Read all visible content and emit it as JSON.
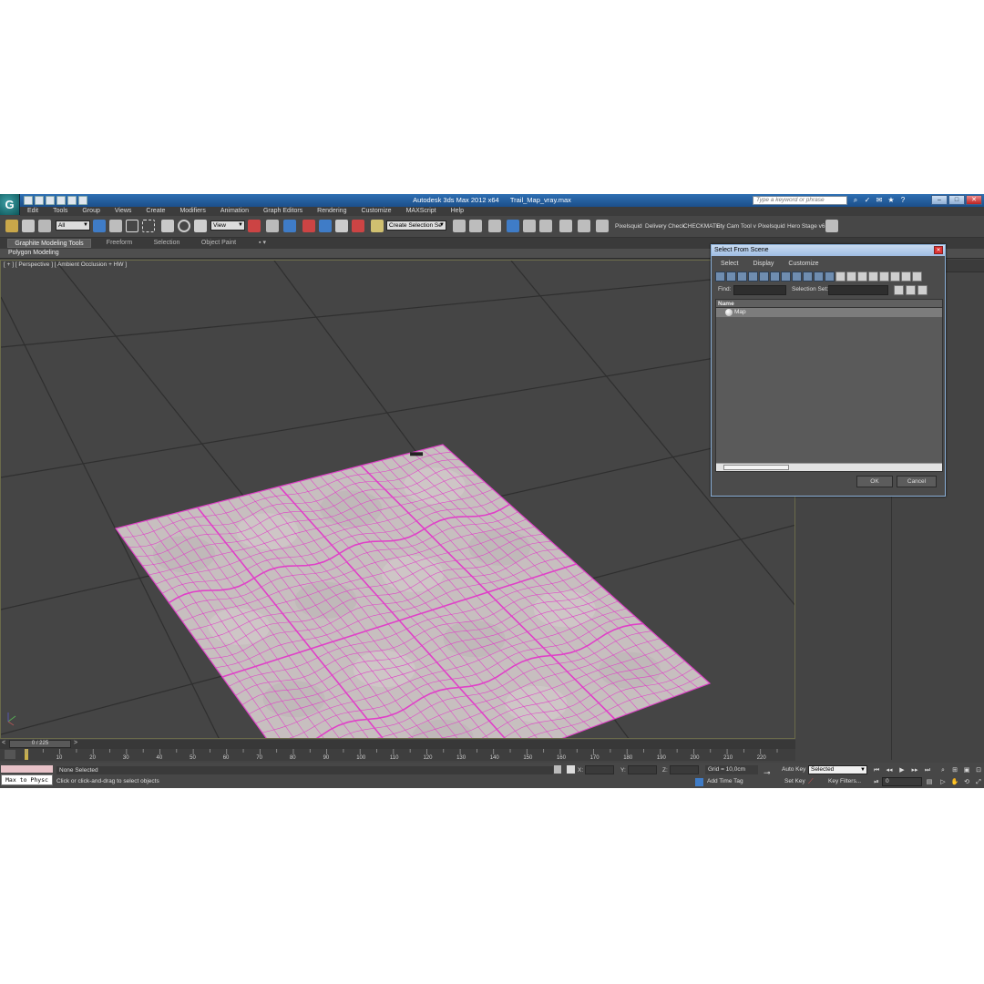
{
  "window": {
    "app_title": "Autodesk 3ds Max  2012 x64",
    "file_title": "Trail_Map_vray.max",
    "search_placeholder": "Type a keyword or phrase"
  },
  "menu": [
    "Edit",
    "Tools",
    "Group",
    "Views",
    "Create",
    "Modifiers",
    "Animation",
    "Graph Editors",
    "Rendering",
    "Customize",
    "MAXScript",
    "Help"
  ],
  "toolbar": {
    "filter_value": "All",
    "ref_coord_value": "View",
    "selection_set_value": "Create Selection Se",
    "plugin_labels": [
      "Pixelsquid",
      "Delivery Check",
      "CHECKMATE",
      "uty Cam Tool v",
      "Pixelsquid",
      "Hero Stage v6"
    ]
  },
  "ribbon": {
    "tabs": [
      "Graphite Modeling Tools",
      "Freeform",
      "Selection",
      "Object Paint"
    ],
    "active_panel": "Polygon Modeling"
  },
  "viewport": {
    "label": "[ + ] [ Perspective ] [ Ambient Occlusion + HW ]",
    "wire_color": "#e040c8",
    "surface_color": "#c7bfbf",
    "background_color": "#454545"
  },
  "dialog": {
    "title": "Select From Scene",
    "menu": [
      "Select",
      "Display",
      "Customize"
    ],
    "find_label": "Find:",
    "selection_set_label": "Selection Set:",
    "column_header": "Name",
    "rows": [
      "Map"
    ],
    "ok_label": "OK",
    "cancel_label": "Cancel"
  },
  "timeline": {
    "slider_label": "0 / 225",
    "ticks": [
      "10",
      "20",
      "30",
      "40",
      "50",
      "60",
      "70",
      "80",
      "90",
      "100",
      "110",
      "120",
      "130",
      "140",
      "150",
      "160",
      "170",
      "180",
      "190",
      "200",
      "210",
      "220"
    ]
  },
  "status": {
    "maxscript_button": "Max to Physc",
    "selection_text": "None Selected",
    "prompt_text": "Click or click-and-drag to select objects",
    "x_label": "X:",
    "y_label": "Y:",
    "z_label": "Z:",
    "grid_text": "Grid = 10,0cm",
    "add_time_tag": "Add Time Tag",
    "auto_key": "Auto Key",
    "set_key": "Set Key",
    "selected_value": "Selected",
    "key_filters": "Key Filters...",
    "frame_value": "0"
  }
}
